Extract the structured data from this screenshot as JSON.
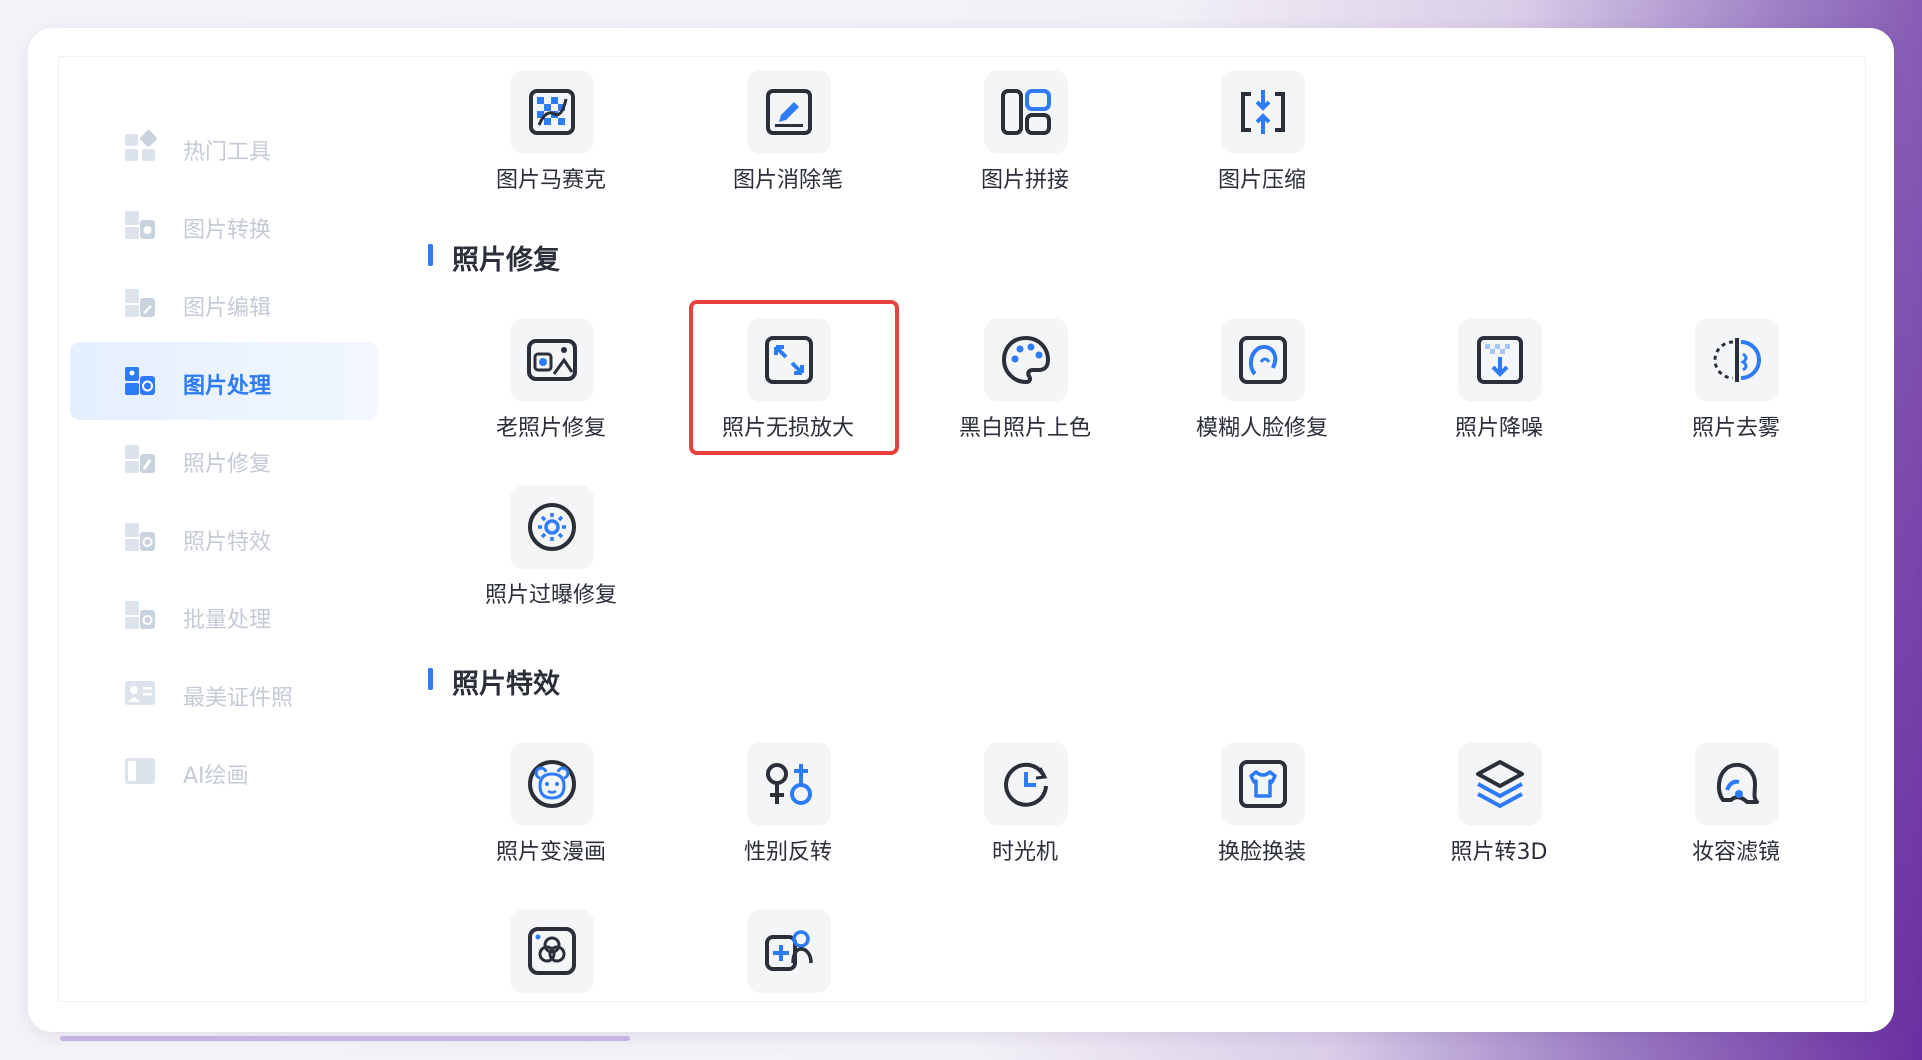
{
  "sidebar": {
    "items": [
      {
        "label": "热门工具",
        "icon": "grid-icon",
        "active": false
      },
      {
        "label": "图片转换",
        "icon": "image-convert-icon",
        "active": false
      },
      {
        "label": "图片编辑",
        "icon": "image-edit-icon",
        "active": false
      },
      {
        "label": "图片处理",
        "icon": "image-process-icon",
        "active": true
      },
      {
        "label": "照片修复",
        "icon": "photo-repair-icon",
        "active": false
      },
      {
        "label": "照片特效",
        "icon": "photo-effect-icon",
        "active": false
      },
      {
        "label": "批量处理",
        "icon": "batch-icon",
        "active": false
      },
      {
        "label": "最美证件照",
        "icon": "id-photo-icon",
        "active": false
      },
      {
        "label": "AI绘画",
        "icon": "ai-paint-icon",
        "active": false
      }
    ]
  },
  "top_tools": [
    {
      "label": "图片马赛克",
      "icon": "mosaic-icon"
    },
    {
      "label": "图片消除笔",
      "icon": "eraser-pen-icon"
    },
    {
      "label": "图片拼接",
      "icon": "collage-icon"
    },
    {
      "label": "图片压缩",
      "icon": "compress-icon"
    }
  ],
  "sections": {
    "repair": {
      "title": "照片修复",
      "tools": [
        {
          "label": "老照片修复",
          "icon": "old-photo-icon"
        },
        {
          "label": "照片无损放大",
          "icon": "enlarge-icon",
          "highlighted": true
        },
        {
          "label": "黑白照片上色",
          "icon": "palette-icon"
        },
        {
          "label": "模糊人脸修复",
          "icon": "face-repair-icon"
        },
        {
          "label": "照片降噪",
          "icon": "denoise-icon"
        },
        {
          "label": "照片去雾",
          "icon": "dehaze-icon"
        },
        {
          "label": "照片过曝修复",
          "icon": "sun-icon"
        }
      ]
    },
    "effects": {
      "title": "照片特效",
      "tools": [
        {
          "label": "照片变漫画",
          "icon": "cartoon-bear-icon"
        },
        {
          "label": "性别反转",
          "icon": "gender-icon"
        },
        {
          "label": "时光机",
          "icon": "clock-icon"
        },
        {
          "label": "换脸换装",
          "icon": "shirt-icon"
        },
        {
          "label": "照片转3D",
          "icon": "layers-icon"
        },
        {
          "label": "妆容滤镜",
          "icon": "makeup-icon"
        },
        {
          "label": "",
          "icon": "color-circles-icon"
        },
        {
          "label": "",
          "icon": "add-person-icon"
        }
      ]
    }
  },
  "colors": {
    "accent": "#2d7bf6",
    "icon_dark": "#2b2f3a",
    "highlight": "#e8403c",
    "sidebar_muted": "#c5cbd6"
  }
}
